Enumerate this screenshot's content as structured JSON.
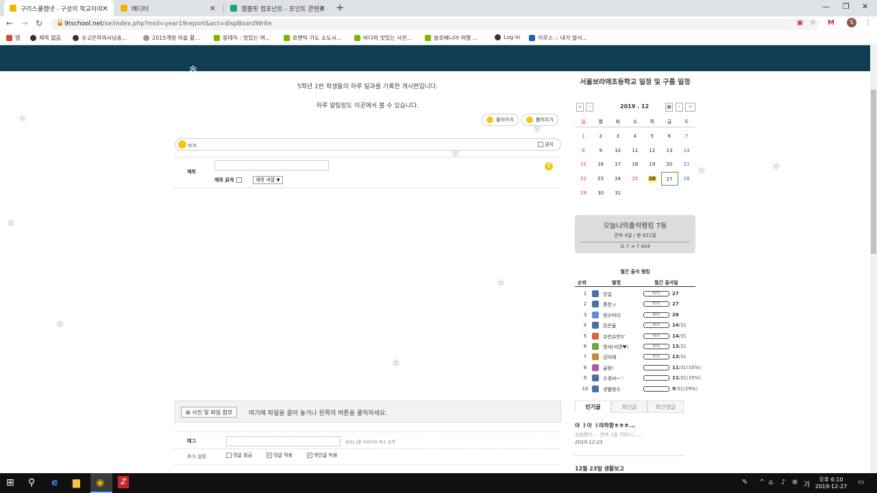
{
  "browser": {
    "tabs": [
      {
        "title": "구리스쿨캠넷 - 구성의 학교이야",
        "active": true
      },
      {
        "title": "에디터",
        "active": false
      },
      {
        "title": "햄볼핏 컴포넌트 - 포인트 콘텐츠",
        "active": false
      }
    ],
    "url_host": "9tschool.net",
    "url_path": "/xe/index.php?mid=year19report&act=dispBoardWrite",
    "profile_initial": "S",
    "bookmarks": [
      "앱",
      "제목 없음",
      "슈고은하의시남송...",
      "2015개정 미술 활...",
      "쏭데이 : 맛있는 여...",
      "로맨틱 가도 소도시...",
      "바다의 맛있는 사진...",
      "슬로베니아 여행 ...",
      "Log In",
      "이루스 :: 내가 알서..."
    ]
  },
  "board": {
    "intro_line1": "5학년 1반 학생들의 하루 일과를 기록한 게시판입니다.",
    "intro_line2": "하루 알림장도 이곳에서 볼 수 있습니다.",
    "back_label": "돌아가기",
    "load_label": "불러오기",
    "write_label": "쓰기",
    "notice_label": "공지",
    "title_label": "제목",
    "title_bold_label": "제목 굵게",
    "title_color_label": "제목 색깔 ▼",
    "attach_button": "사진 및 파일 첨부",
    "attach_hint": "여기에 파일을 끌어 놓거나 왼쪽의 버튼을 클릭하세요.",
    "tag_label": "태그",
    "tag_help": "쉼표(,)를 이용하여 복수 등록",
    "extra_label": "추가 설정",
    "opt_lock_comment": "댓글 잠금",
    "opt_allow_comment": "댓글 허용",
    "opt_allow_trackback": "엮인글 허용"
  },
  "calendar": {
    "title": "서울보라매초등학교 일정 및 구름 일정",
    "year_month": "2019 . 12",
    "weekdays": [
      "일",
      "월",
      "화",
      "수",
      "목",
      "금",
      "토"
    ],
    "weeks": [
      [
        "1",
        "2",
        "3",
        "4",
        "5",
        "6",
        "7"
      ],
      [
        "8",
        "9",
        "10",
        "11",
        "12",
        "13",
        "14"
      ],
      [
        "15",
        "16",
        "17",
        "18",
        "19",
        "20",
        "21"
      ],
      [
        "22",
        "23",
        "24",
        "25",
        "26",
        "27",
        "28"
      ],
      [
        "29",
        "30",
        "31",
        "",
        "",
        "",
        ""
      ]
    ],
    "holiday": "25",
    "marked": "26",
    "today": "27"
  },
  "attendance": {
    "rank_text": "오늘나의출석랭킹 7등",
    "streak_text": "연속 4일 / 총 621일",
    "stat_text": "☑ 7 ➜ 7  404"
  },
  "monthly_rank": {
    "title": "월간 출석 랭킹",
    "headers": [
      "순위",
      "별명",
      "월간 출석일"
    ],
    "rows": [
      {
        "rank": "1",
        "name": "엉섭",
        "pct": "87%",
        "days": "27",
        "denom": "",
        "color": "#4a6fa5"
      },
      {
        "rank": "2",
        "name": "풍찬ッ",
        "pct": "87%",
        "days": "27",
        "denom": "",
        "color": "#4a6fa5"
      },
      {
        "rank": "3",
        "name": "청수머더",
        "pct": "80%",
        "days": "26",
        "denom": "",
        "color": "#5b8fd0"
      },
      {
        "rank": "4",
        "name": "킹은율",
        "pct": "45%",
        "days": "14",
        "denom": "/31",
        "color": "#4a6fa5"
      },
      {
        "rank": "5",
        "name": "슈만슈만3'",
        "pct": "45%",
        "days": "14",
        "denom": "/31",
        "color": "#d46a3a"
      },
      {
        "rank": "6",
        "name": "영서(서영♥)",
        "pct": "41%",
        "days": "13",
        "denom": "/31",
        "color": "#6aa84f"
      },
      {
        "rank": "7",
        "name": "김아채",
        "pct": "41%",
        "days": "13",
        "denom": "/31",
        "color": "#c98a3a"
      },
      {
        "rank": "8",
        "name": "골랑!",
        "pct": "",
        "days": "11",
        "denom": "/31(35%)",
        "color": "#b05aa0"
      },
      {
        "rank": "9",
        "name": "수경씨~♡",
        "pct": "",
        "days": "11",
        "denom": "/31(35%)",
        "color": "#4a6fa5"
      },
      {
        "rank": "10",
        "name": "샛별청수",
        "pct": "",
        "days": "9",
        "denom": "/31(29%)",
        "color": "#4a6fa5"
      }
    ]
  },
  "post_tabs": [
    "인기글",
    "최신글",
    "최신댓글"
  ],
  "popular_posts": [
    {
      "title": "아 ㅏ아 ㅓ라하항ㅎㅎㅎ...",
      "excerpt": "심심했다.... 연속 1일 이라니......",
      "date": "2019-12-23"
    },
    {
      "title": "12월 23일 생활보고",
      "excerpt": "",
      "date": ""
    }
  ],
  "taskbar": {
    "time": "오후 6:10",
    "date": "2019-12-27"
  }
}
